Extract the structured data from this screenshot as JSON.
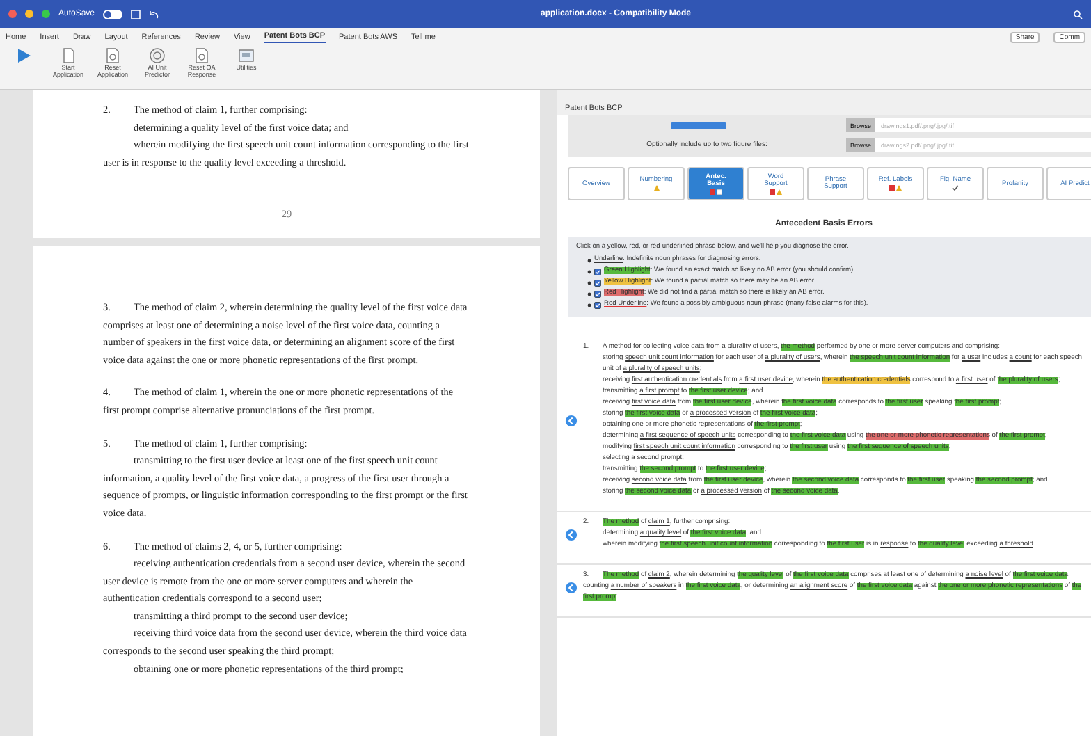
{
  "window": {
    "autosave": "AutoSave",
    "autosave_on": false,
    "title": "application.docx - Compatibility Mode"
  },
  "menu": [
    {
      "label": "Home",
      "selected": false
    },
    {
      "label": "Insert",
      "selected": false
    },
    {
      "label": "Draw",
      "selected": false
    },
    {
      "label": "Layout",
      "selected": false
    },
    {
      "label": "References",
      "selected": false
    },
    {
      "label": "Review",
      "selected": false
    },
    {
      "label": "View",
      "selected": false
    },
    {
      "label": "Patent Bots BCP",
      "selected": true
    },
    {
      "label": "Patent Bots AWS",
      "selected": false
    },
    {
      "label": "Tell me",
      "selected": false
    }
  ],
  "share": "Share",
  "comments": "Comm",
  "ribbon": [
    {
      "kind": "play"
    },
    {
      "label": "Start Application",
      "kind": "doc"
    },
    {
      "label": "Reset Application",
      "kind": "search"
    },
    {
      "label": "AI Unit Predictor",
      "kind": "circle"
    },
    {
      "label": "Reset OA Response",
      "kind": "search"
    },
    {
      "label": "Utilities",
      "kind": "box"
    }
  ],
  "pages": [
    {
      "number": "29",
      "claims": [
        {
          "number": "2.",
          "lines": [
            "The method of claim 1, further comprising:",
            "determining a quality level of the first voice data; and",
            "wherein modifying the first speech unit count information corresponding to the first user is in response to the quality level exceeding a threshold."
          ]
        }
      ]
    },
    {
      "claims": [
        {
          "number": "3.",
          "lines": [
            "The method of claim 2, wherein determining the quality level of the first voice data comprises at least one of determining a noise level of the first voice data, counting a number of speakers in the first voice data, or determining an alignment score of the first voice data against the one or more phonetic representations of the first prompt."
          ]
        },
        {
          "number": "4.",
          "lines": [
            "The method of claim 1, wherein the one or more phonetic representations of the first prompt comprise alternative pronunciations of the first prompt."
          ]
        },
        {
          "number": "5.",
          "lines": [
            "The method of claim 1, further comprising:",
            "transmitting to the first user device at least one of the first speech unit count information, a quality level of the first voice data, a progress of the first user through a sequence of prompts, or linguistic information corresponding to the first prompt or the first voice data."
          ]
        },
        {
          "number": "6.",
          "lines": [
            "The method of claims 2, 4, or 5, further comprising:",
            "receiving authentication credentials from a second user device, wherein the second user device is remote from the one or more server computers and wherein the authentication credentials correspond to a second user;",
            "transmitting a third prompt to the second user device;",
            "receiving third voice data from the second user device, wherein the third voice data corresponds to the second user speaking the third prompt;",
            "obtaining one or more phonetic representations of the third prompt;"
          ]
        }
      ]
    }
  ],
  "panel": {
    "title": "Patent Bots BCP",
    "files": [
      {
        "button": "Browse",
        "placeholder": "drawings1.pdf/.png/.jpg/.tif"
      },
      {
        "button": "Browse",
        "placeholder": "drawings2.pdf/.png/.jpg/.tif"
      }
    ],
    "figure_note": "Optionally include up to two figure files:",
    "tabs": [
      {
        "label": "Overview",
        "selected": false
      },
      {
        "label": "Numbering",
        "selected": false,
        "status": [
          {
            "kind": "warning"
          }
        ]
      },
      {
        "label": "Antec. Basis",
        "selected": true,
        "status": [
          {
            "kind": "error"
          },
          {
            "kind": "info"
          }
        ]
      },
      {
        "label": "Word Support",
        "selected": false,
        "status": [
          {
            "kind": "error"
          },
          {
            "kind": "warning"
          }
        ]
      },
      {
        "label": "Phrase Support",
        "selected": false
      },
      {
        "label": "Ref. Labels",
        "selected": false,
        "status": [
          {
            "kind": "error"
          },
          {
            "kind": "warning"
          }
        ]
      },
      {
        "label": "Fig. Name",
        "selected": false,
        "status": [
          {
            "kind": "ok"
          }
        ]
      },
      {
        "label": "Profanity",
        "selected": false
      },
      {
        "label": "AI Predict",
        "selected": false
      }
    ],
    "heading": "Antecedent Basis Errors",
    "intro": "Click on a yellow, red, or red-underlined phrase below, and we'll help you diagnose the error.",
    "legend_note": {
      "label": "Underline",
      "text": ": Indefinite noun phrases for diagnosing errors."
    },
    "legend": [
      {
        "kind": "green",
        "checked": true,
        "label": "Green Highlight",
        "text": ": We found an exact match so likely no AB error (you should confirm)."
      },
      {
        "kind": "yellow",
        "checked": true,
        "label": "Yellow Highlight",
        "text": ": We found a partial match so there may be an AB error."
      },
      {
        "kind": "red",
        "checked": true,
        "label": "Red Highlight",
        "text": ": We did not find a partial match so there is likely an AB error."
      },
      {
        "kind": "redunderline",
        "checked": true,
        "label": "Red Underline",
        "text": ": We found a possibly ambiguous noun phrase (many false alarms for this)."
      }
    ],
    "claims": [
      {
        "number": "1.",
        "paras": [
          [
            {
              "text": "A method for collecting voice data from a plurality of users, ",
              "kind": "plain"
            },
            {
              "text": "the method",
              "kind": "green"
            },
            {
              "text": " performed by one or more server computers and comprising:",
              "kind": "plain"
            }
          ],
          [
            {
              "text": "storing ",
              "kind": "plain"
            },
            {
              "text": "speech unit count information",
              "kind": "underline"
            },
            {
              "text": " for each user of ",
              "kind": "plain"
            },
            {
              "text": "a plurality of users",
              "kind": "underline"
            },
            {
              "text": ", wherein ",
              "kind": "plain"
            },
            {
              "text": "the speech unit count information",
              "kind": "green"
            },
            {
              "text": " for ",
              "kind": "plain"
            },
            {
              "text": "a user",
              "kind": "underline"
            },
            {
              "text": " includes ",
              "kind": "plain"
            },
            {
              "text": "a count",
              "kind": "underline"
            },
            {
              "text": " for each speech unit of ",
              "kind": "plain"
            },
            {
              "text": "a plurality of speech units",
              "kind": "underline"
            },
            {
              "text": ";",
              "kind": "plain"
            }
          ],
          [
            {
              "text": "receiving ",
              "kind": "plain"
            },
            {
              "text": "first authentication credentials",
              "kind": "underline"
            },
            {
              "text": " from ",
              "kind": "plain"
            },
            {
              "text": "a first user device",
              "kind": "underline"
            },
            {
              "text": ", wherein ",
              "kind": "plain"
            },
            {
              "text": "the authentication credentials",
              "kind": "yellow"
            },
            {
              "text": " correspond to ",
              "kind": "plain"
            },
            {
              "text": "a first user",
              "kind": "underline"
            },
            {
              "text": " of ",
              "kind": "plain"
            },
            {
              "text": "the plurality of users",
              "kind": "green"
            },
            {
              "text": ";",
              "kind": "plain"
            }
          ],
          [
            {
              "text": "transmitting ",
              "kind": "plain"
            },
            {
              "text": "a first prompt",
              "kind": "underline"
            },
            {
              "text": " to ",
              "kind": "plain"
            },
            {
              "text": "the first user device",
              "kind": "green"
            },
            {
              "text": "; and",
              "kind": "plain"
            }
          ],
          [
            {
              "text": "receiving ",
              "kind": "plain"
            },
            {
              "text": "first voice data",
              "kind": "underline"
            },
            {
              "text": " from ",
              "kind": "plain"
            },
            {
              "text": "the first user device",
              "kind": "green"
            },
            {
              "text": ", wherein ",
              "kind": "plain"
            },
            {
              "text": "the first voice data",
              "kind": "green"
            },
            {
              "text": " corresponds to ",
              "kind": "plain"
            },
            {
              "text": "the first user",
              "kind": "green"
            },
            {
              "text": " speaking ",
              "kind": "plain"
            },
            {
              "text": "the first prompt",
              "kind": "green"
            },
            {
              "text": ";",
              "kind": "plain"
            }
          ],
          [
            {
              "text": "storing ",
              "kind": "plain"
            },
            {
              "text": "the first voice data",
              "kind": "green"
            },
            {
              "text": " or ",
              "kind": "plain"
            },
            {
              "text": "a processed version",
              "kind": "underline"
            },
            {
              "text": " of ",
              "kind": "plain"
            },
            {
              "text": "the first voice data",
              "kind": "green"
            },
            {
              "text": ";",
              "kind": "plain"
            }
          ],
          [
            {
              "text": "obtaining one or more phonetic representations of ",
              "kind": "plain"
            },
            {
              "text": "the first prompt",
              "kind": "green"
            },
            {
              "text": ";",
              "kind": "plain"
            }
          ],
          [
            {
              "text": "determining ",
              "kind": "plain"
            },
            {
              "text": "a first sequence of speech units",
              "kind": "underline"
            },
            {
              "text": " corresponding to ",
              "kind": "plain"
            },
            {
              "text": "the first voice data",
              "kind": "green"
            },
            {
              "text": " using ",
              "kind": "plain"
            },
            {
              "text": "the one or more phonetic representations",
              "kind": "red"
            },
            {
              "text": " of ",
              "kind": "plain"
            },
            {
              "text": "the first prompt",
              "kind": "green"
            },
            {
              "text": ";",
              "kind": "plain"
            }
          ],
          [
            {
              "text": "modifying ",
              "kind": "plain"
            },
            {
              "text": "first speech unit count information",
              "kind": "underline"
            },
            {
              "text": " corresponding to ",
              "kind": "plain"
            },
            {
              "text": "the first user",
              "kind": "green"
            },
            {
              "text": " using ",
              "kind": "plain"
            },
            {
              "text": "the first sequence of speech units",
              "kind": "green"
            },
            {
              "text": ";",
              "kind": "plain"
            }
          ],
          [
            {
              "text": "selecting a second prompt;",
              "kind": "plain"
            }
          ],
          [
            {
              "text": "transmitting ",
              "kind": "plain"
            },
            {
              "text": "the second prompt",
              "kind": "green"
            },
            {
              "text": " to ",
              "kind": "plain"
            },
            {
              "text": "the first user device",
              "kind": "green"
            },
            {
              "text": ";",
              "kind": "plain"
            }
          ],
          [
            {
              "text": "receiving ",
              "kind": "plain"
            },
            {
              "text": "second voice data",
              "kind": "underline"
            },
            {
              "text": " from ",
              "kind": "plain"
            },
            {
              "text": "the first user device",
              "kind": "green"
            },
            {
              "text": ", wherein ",
              "kind": "plain"
            },
            {
              "text": "the second voice data",
              "kind": "green"
            },
            {
              "text": " corresponds to ",
              "kind": "plain"
            },
            {
              "text": "the first user",
              "kind": "green"
            },
            {
              "text": " speaking ",
              "kind": "plain"
            },
            {
              "text": "the second prompt",
              "kind": "green"
            },
            {
              "text": "; and",
              "kind": "plain"
            }
          ],
          [
            {
              "text": "storing ",
              "kind": "plain"
            },
            {
              "text": "the second voice data",
              "kind": "green"
            },
            {
              "text": " or ",
              "kind": "plain"
            },
            {
              "text": "a processed version",
              "kind": "underline"
            },
            {
              "text": " of ",
              "kind": "plain"
            },
            {
              "text": "the second voice data",
              "kind": "green"
            },
            {
              "text": ".",
              "kind": "plain"
            }
          ]
        ]
      },
      {
        "number": "2.",
        "paras": [
          [
            {
              "text": "The method",
              "kind": "green"
            },
            {
              "text": " of ",
              "kind": "plain"
            },
            {
              "text": "claim 1",
              "kind": "underline"
            },
            {
              "text": ", further comprising:",
              "kind": "plain"
            }
          ],
          [
            {
              "text": "determining ",
              "kind": "plain"
            },
            {
              "text": "a quality level",
              "kind": "underline"
            },
            {
              "text": " of ",
              "kind": "plain"
            },
            {
              "text": "the first voice data",
              "kind": "green"
            },
            {
              "text": "; and",
              "kind": "plain"
            }
          ],
          [
            {
              "text": "wherein modifying ",
              "kind": "plain"
            },
            {
              "text": "the first speech unit count information",
              "kind": "green"
            },
            {
              "text": " corresponding to ",
              "kind": "plain"
            },
            {
              "text": "the first user",
              "kind": "green"
            },
            {
              "text": " is in ",
              "kind": "plain"
            },
            {
              "text": "response",
              "kind": "underline"
            },
            {
              "text": " to ",
              "kind": "plain"
            },
            {
              "text": "the quality level",
              "kind": "green"
            },
            {
              "text": " exceeding ",
              "kind": "plain"
            },
            {
              "text": "a threshold",
              "kind": "underline"
            },
            {
              "text": ".",
              "kind": "plain"
            }
          ]
        ]
      },
      {
        "number": "3.",
        "paras": [
          [
            {
              "text": "The method",
              "kind": "green"
            },
            {
              "text": " of ",
              "kind": "plain"
            },
            {
              "text": "claim 2",
              "kind": "underline"
            },
            {
              "text": ", wherein determining ",
              "kind": "plain"
            },
            {
              "text": "the quality level",
              "kind": "green"
            },
            {
              "text": " of ",
              "kind": "plain"
            },
            {
              "text": "the first voice data",
              "kind": "green"
            },
            {
              "text": " comprises at least one of determining ",
              "kind": "plain"
            },
            {
              "text": "a noise level",
              "kind": "underline"
            },
            {
              "text": " of ",
              "kind": "plain"
            },
            {
              "text": "the first voice data",
              "kind": "green"
            },
            {
              "text": ", counting ",
              "kind": "plain"
            },
            {
              "text": "a number of speakers",
              "kind": "underline"
            },
            {
              "text": " in ",
              "kind": "plain"
            },
            {
              "text": "the first voice data",
              "kind": "green"
            },
            {
              "text": ", or determining ",
              "kind": "plain"
            },
            {
              "text": "an alignment score",
              "kind": "underline"
            },
            {
              "text": " of ",
              "kind": "plain"
            },
            {
              "text": "the first voice data",
              "kind": "green"
            },
            {
              "text": " against ",
              "kind": "plain"
            },
            {
              "text": "the one or more phonetic representations",
              "kind": "green"
            },
            {
              "text": " of ",
              "kind": "plain"
            },
            {
              "text": "the first prompt",
              "kind": "green"
            },
            {
              "text": ".",
              "kind": "plain"
            }
          ]
        ]
      }
    ]
  }
}
